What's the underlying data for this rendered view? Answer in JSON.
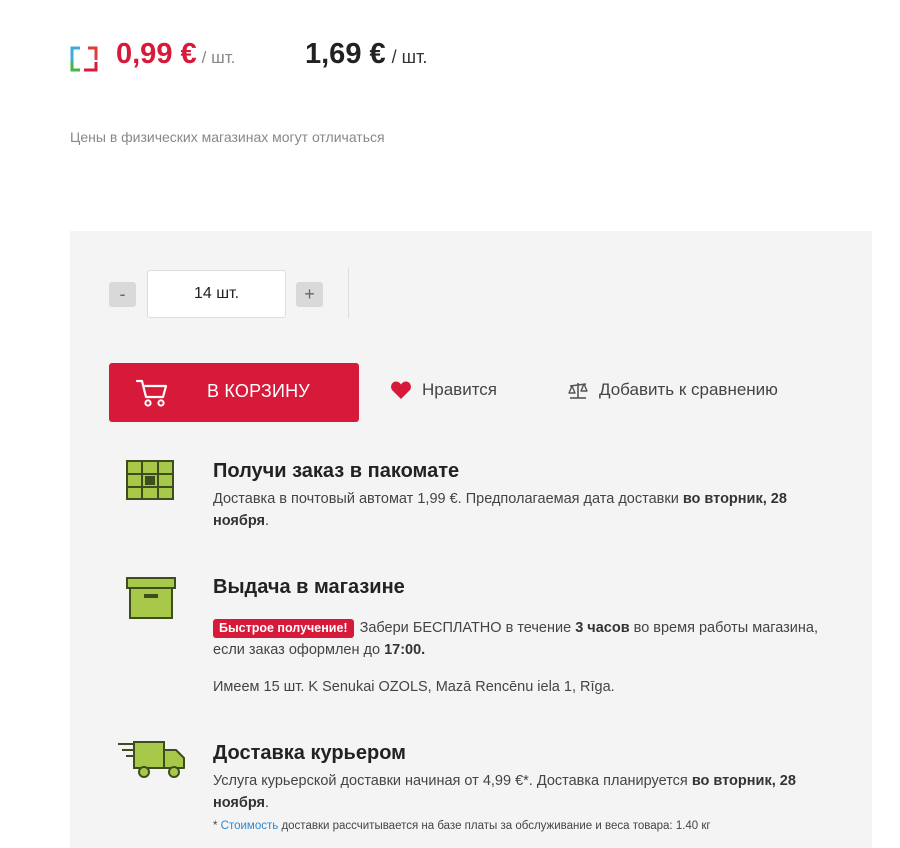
{
  "price": {
    "club_value": "0,99 €",
    "club_unit": "/ шт.",
    "regular_value": "1,69 €",
    "regular_unit": "/ шт.",
    "disclaimer": "Цены в физических магазинах могут отличаться"
  },
  "quantity": {
    "minus_label": "-",
    "value": "14 шт.",
    "plus_label": "+"
  },
  "actions": {
    "cart_label": "В КОРЗИНУ",
    "like_label": "Нравится",
    "compare_label": "Добавить к сравнению"
  },
  "delivery": {
    "parcel": {
      "title": "Получи заказ в пакомате",
      "text_a": "Доставка в почтовый автомат 1,99 €. Предполагаемая дата доставки ",
      "text_b": "во вторник, 28 ноября",
      "text_c": "."
    },
    "store": {
      "title": "Выдача в магазине",
      "badge": "Быстрое получение!",
      "text_a": "Забери БЕСПЛАТНО в течение ",
      "text_b": "3 часов",
      "text_c": " во время работы магазина, если заказ оформлен до ",
      "text_d": "17:00.",
      "stock": "Имеем 15 шт. K Senukai OZOLS, Mazā Rencēnu iela 1, Rīga."
    },
    "courier": {
      "title": "Доставка курьером",
      "text_a": "Услуга курьерской доставки начиная от 4,99 €*. Доставка планируется ",
      "text_b": "во вторник, 28 ноября",
      "text_c": ".",
      "note_prefix": "* ",
      "note_link": "Стоимость",
      "note_rest": " доставки рассчитывается на базе платы за обслуживание и веса товара: 1.40 кг"
    }
  },
  "colors": {
    "accent": "#d7193a",
    "icon_green": "#a8c84a",
    "link": "#2b8ad6",
    "panel": "#f4f4f4"
  },
  "icons": [
    "club-card-icon",
    "cart-icon",
    "heart-icon",
    "compare-icon",
    "parcel-locker-icon",
    "store-box-icon",
    "courier-truck-icon"
  ]
}
